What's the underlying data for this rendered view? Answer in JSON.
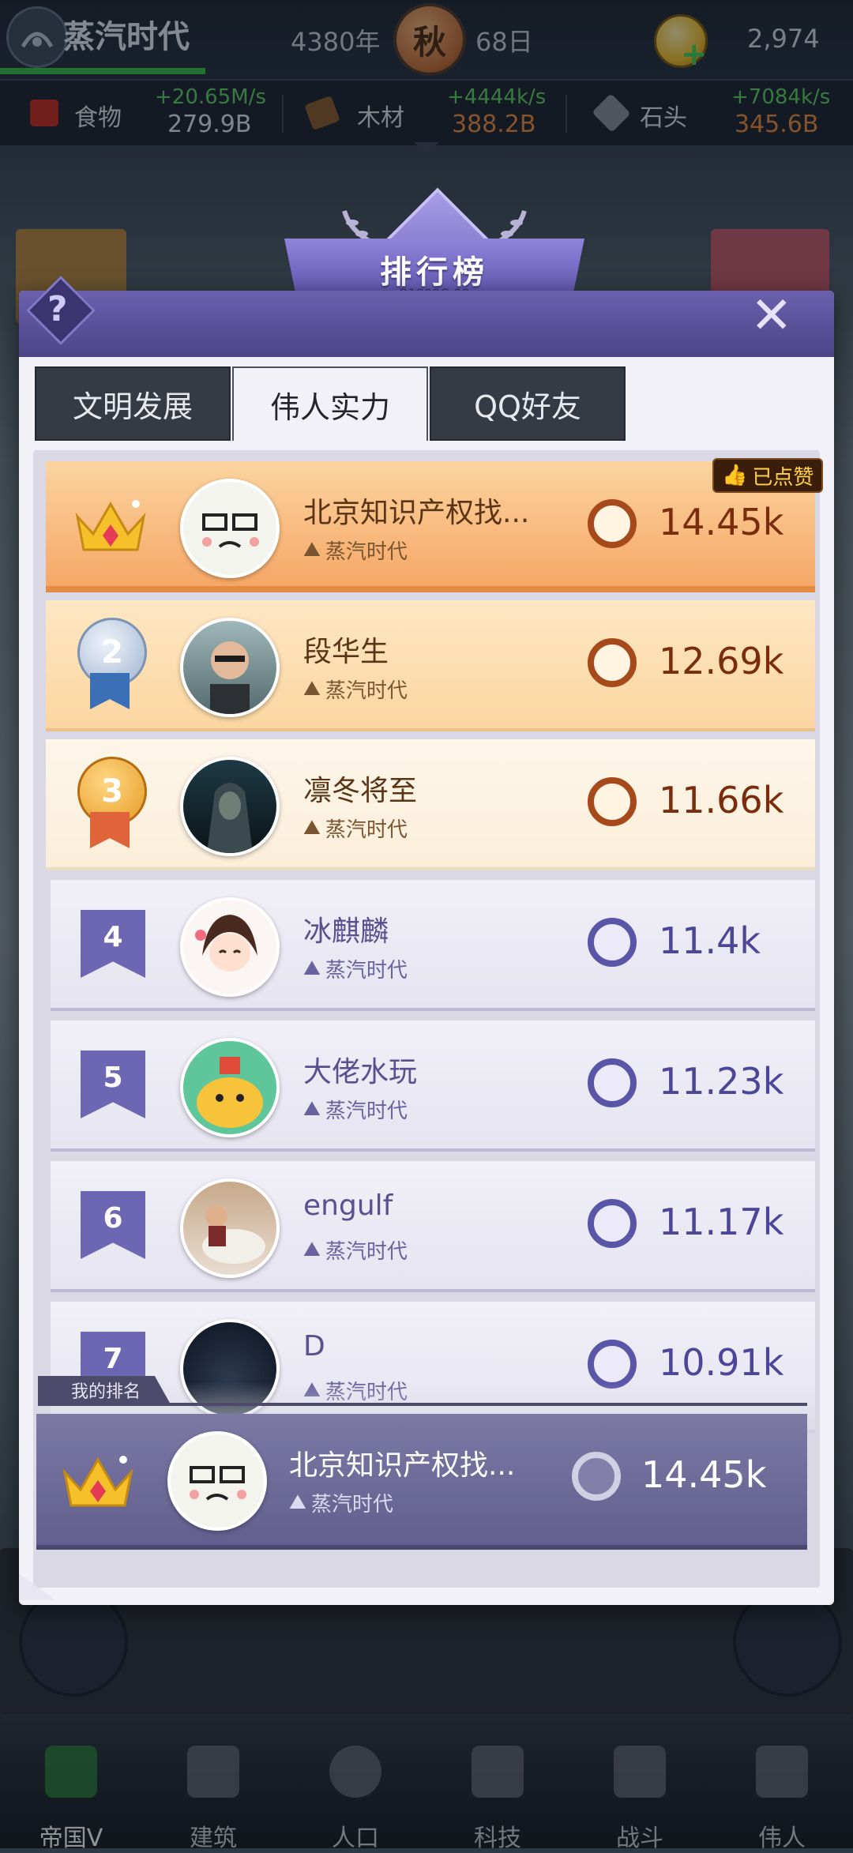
{
  "topbar": {
    "game_title": "蒸汽时代",
    "year": "4380年",
    "season": "秋",
    "day": "68日",
    "coins": "2,974"
  },
  "resources": [
    {
      "name": "食物",
      "rate": "+20.65M/s",
      "amount": "279.9B",
      "icon": "food-crate-icon",
      "amount_color": "#e0e5ea"
    },
    {
      "name": "木材",
      "rate": "+4444k/s",
      "amount": "388.2B",
      "icon": "wood-log-icon",
      "amount_color": "#e98a3c"
    },
    {
      "name": "石头",
      "rate": "+7084k/s",
      "amount": "345.6B",
      "icon": "stone-icon",
      "amount_color": "#e98a3c"
    }
  ],
  "modal": {
    "title": "排行榜",
    "code": "B1809C-08",
    "help_label": "?",
    "close_label": "✕",
    "tabs": [
      {
        "label": "文明发展",
        "active": false
      },
      {
        "label": "伟人实力",
        "active": true
      },
      {
        "label": "QQ好友",
        "active": false
      }
    ],
    "liked_label": "已点赞",
    "rows": [
      {
        "rank": "1",
        "name": "北京知识产权找...",
        "city": "蒸汽时代",
        "value": "14.45k",
        "badge": "crown"
      },
      {
        "rank": "2",
        "name": "段华生",
        "city": "蒸汽时代",
        "value": "12.69k",
        "badge": "silver-medal"
      },
      {
        "rank": "3",
        "name": "凛冬将至",
        "city": "蒸汽时代",
        "value": "11.66k",
        "badge": "bronze-medal"
      },
      {
        "rank": "4",
        "name": "冰麒麟",
        "city": "蒸汽时代",
        "value": "11.4k",
        "badge": "ribbon"
      },
      {
        "rank": "5",
        "name": "大佬水玩",
        "city": "蒸汽时代",
        "value": "11.23k",
        "badge": "ribbon"
      },
      {
        "rank": "6",
        "name": "engulf",
        "city": "蒸汽时代",
        "value": "11.17k",
        "badge": "ribbon"
      },
      {
        "rank": "7",
        "name": "D",
        "city": "蒸汽时代",
        "value": "10.91k",
        "badge": "ribbon"
      }
    ],
    "my_rank_label": "我的排名",
    "my_row": {
      "name": "北京知识产权找...",
      "city": "蒸汽时代",
      "value": "14.45k"
    }
  },
  "bottom_nav": [
    {
      "label": "帝国V",
      "active": true
    },
    {
      "label": "建筑",
      "active": false
    },
    {
      "label": "人口",
      "active": false
    },
    {
      "label": "科技",
      "active": false
    },
    {
      "label": "战斗",
      "active": false
    },
    {
      "label": "伟人",
      "active": false
    }
  ]
}
